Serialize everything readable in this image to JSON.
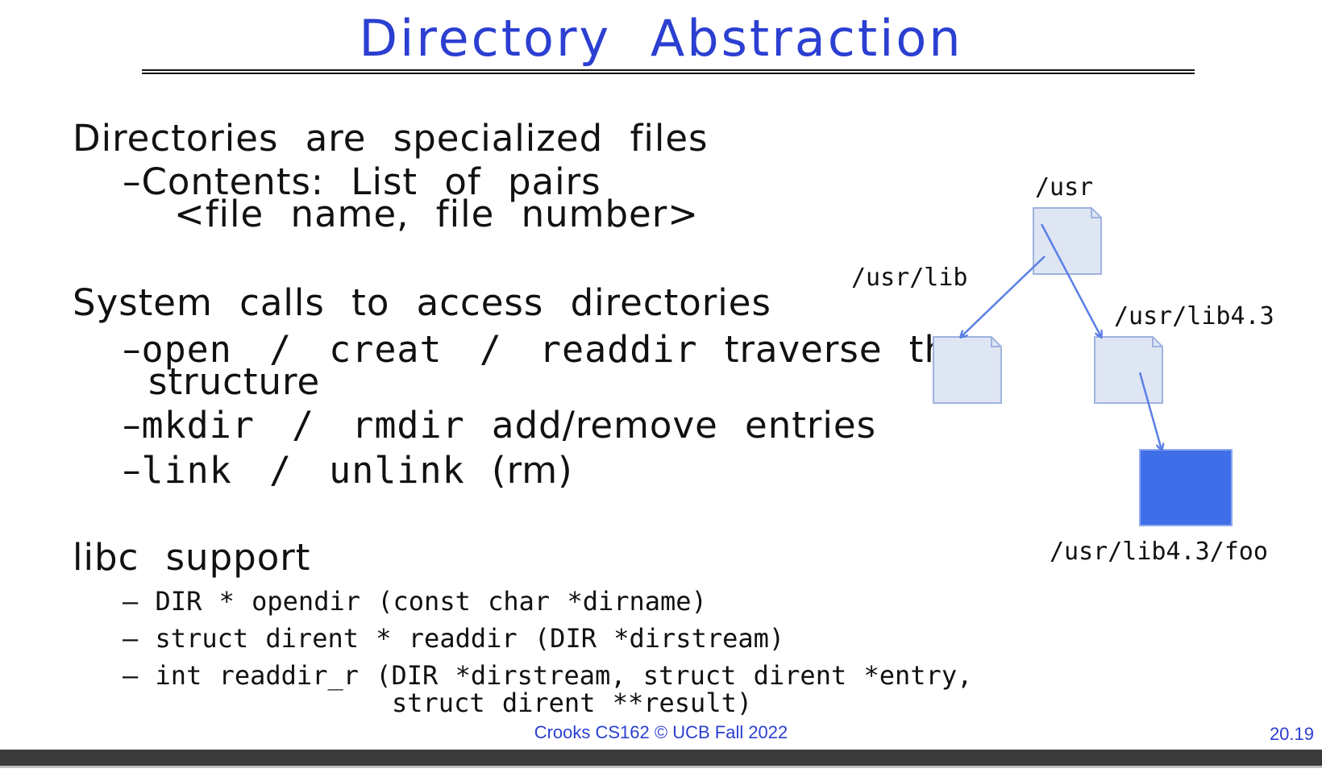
{
  "slide": {
    "title": "Directory Abstraction",
    "b1": "Directories are specialized files",
    "b1_sub_l1": "Contents: List of pairs",
    "b1_sub_l2": "<file name, file number>",
    "b2": "System calls to access directories",
    "b2_s1_code": "open / creat / readdir",
    "b2_s1_text": " traverse the",
    "b2_s1_l2": "structure",
    "b2_s2_code": "mkdir / rmdir",
    "b2_s2_text": " add/remove entries",
    "b2_s3_code": "link / unlink",
    "b2_s3_text": " (rm)",
    "b3": "libc support",
    "libc1": "DIR * opendir (const char *dirname)",
    "libc2": "struct dirent * readdir (DIR *dirstream)",
    "libc3_l1": "int readdir_r (DIR *dirstream, struct dirent *entry,",
    "libc3_l2": "struct dirent **result)"
  },
  "dash": "–",
  "diagram": {
    "labels": {
      "usr": "/usr",
      "usr_lib": "/usr/lib",
      "usr_lib43": "/usr/lib4.3",
      "foo": "/usr/lib4.3/foo"
    }
  },
  "footer": {
    "course": "Crooks CS162 © UCB Fall 2022",
    "slide_number": "20.19"
  },
  "colors": {
    "title": "#2b3fd1",
    "file_fill": "#dfe6f3",
    "file_stroke": "#9fb3e0",
    "arrow": "#5b7fe6",
    "foo_fill": "#3f6fe8"
  }
}
